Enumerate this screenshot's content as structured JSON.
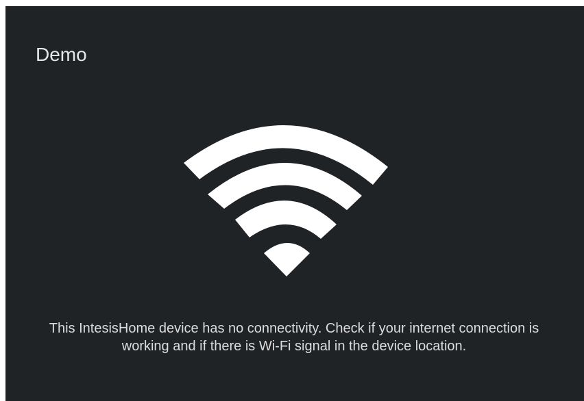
{
  "device": {
    "title": "Demo"
  },
  "status": {
    "icon": "wifi-icon",
    "message": "This IntesisHome device has no connectivity. Check if your internet connection is working and if there is Wi-Fi signal in the device location."
  },
  "colors": {
    "background": "#202326",
    "icon": "#ffffff",
    "text": "#dcdcdc"
  }
}
